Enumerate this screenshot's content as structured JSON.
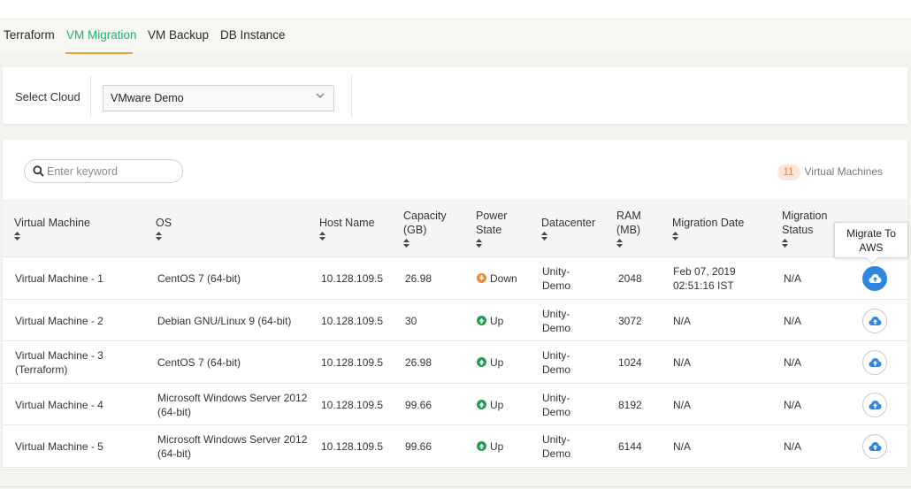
{
  "tabs": [
    {
      "label": "Terraform",
      "active": false
    },
    {
      "label": "VM Migration",
      "active": true
    },
    {
      "label": "VM Backup",
      "active": false
    },
    {
      "label": "DB Instance",
      "active": false
    }
  ],
  "cloud_selector": {
    "label": "Select Cloud",
    "selected": "VMware Demo"
  },
  "search": {
    "placeholder": "Enter keyword",
    "value": ""
  },
  "vm_count": {
    "count": "11",
    "label": "Virtual Machines"
  },
  "columns": {
    "vm": "Virtual Machine",
    "os": "OS",
    "host": "Host Name",
    "capacity": "Capacity (GB)",
    "power": "Power State",
    "datacenter": "Datacenter",
    "ram": "RAM (MB)",
    "migration_date": "Migration Date",
    "migration_status": "Migration Status"
  },
  "tooltip": {
    "text": "Migrate To AWS"
  },
  "rows": [
    {
      "vm": "Virtual Machine - 1",
      "os": "CentOS 7 (64-bit)",
      "host": "10.128.109.5",
      "capacity": "26.98",
      "power": "Down",
      "datacenter": "Unity-Demo",
      "ram": "2048",
      "migration_date": "Feb 07, 2019 02:51:16 IST",
      "migration_status": "N/A"
    },
    {
      "vm": "Virtual Machine - 2",
      "os": "Debian GNU/Linux 9 (64-bit)",
      "host": "10.128.109.5",
      "capacity": "30",
      "power": "Up",
      "datacenter": "Unity-Demo",
      "ram": "3072",
      "migration_date": "N/A",
      "migration_status": "N/A"
    },
    {
      "vm": "Virtual Machine - 3 (Terraform)",
      "os": "CentOS 7 (64-bit)",
      "host": "10.128.109.5",
      "capacity": "26.98",
      "power": "Up",
      "datacenter": "Unity-Demo",
      "ram": "1024",
      "migration_date": "N/A",
      "migration_status": "N/A"
    },
    {
      "vm": "Virtual Machine - 4",
      "os": "Microsoft Windows Server 2012 (64-bit)",
      "host": "10.128.109.5",
      "capacity": "99.66",
      "power": "Up",
      "datacenter": "Unity-Demo",
      "ram": "8192",
      "migration_date": "N/A",
      "migration_status": "N/A"
    },
    {
      "vm": "Virtual Machine - 5",
      "os": "Microsoft Windows Server 2012 (64-bit)",
      "host": "10.128.109.5",
      "capacity": "99.66",
      "power": "Up",
      "datacenter": "Unity-Demo",
      "ram": "6144",
      "migration_date": "N/A",
      "migration_status": "N/A"
    }
  ],
  "colors": {
    "accent_green": "#23b06a",
    "tab_underline": "#f5a035",
    "state_up": "#1f9d4f",
    "state_down": "#ef8a2a",
    "migrate_active": "#2f86e0",
    "badge_bg": "#fbe6d8",
    "badge_text": "#e8803e"
  },
  "icons": {
    "search": "search-icon",
    "sort": "sort-icon",
    "state_up": "arrow-up-circle-icon",
    "state_down": "arrow-down-circle-icon",
    "migrate": "cloud-upload-icon",
    "dropdown": "chevron-down-icon"
  }
}
